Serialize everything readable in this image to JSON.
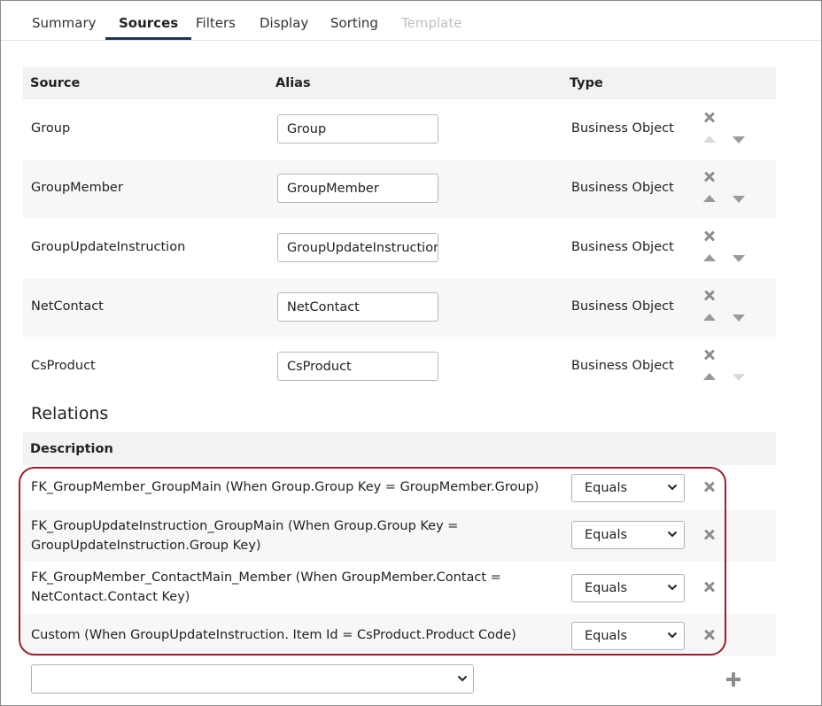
{
  "tabs": [
    {
      "label": "Summary",
      "state": "normal"
    },
    {
      "label": "Sources",
      "state": "active"
    },
    {
      "label": "Filters",
      "state": "normal"
    },
    {
      "label": "Display",
      "state": "normal"
    },
    {
      "label": "Sorting",
      "state": "normal"
    },
    {
      "label": "Template",
      "state": "disabled"
    }
  ],
  "sources": {
    "headers": {
      "source": "Source",
      "alias": "Alias",
      "type": "Type"
    },
    "rows": [
      {
        "source": "Group",
        "alias": "Group",
        "type": "Business Object"
      },
      {
        "source": "GroupMember",
        "alias": "GroupMember",
        "type": "Business Object"
      },
      {
        "source": "GroupUpdateInstruction",
        "alias": "GroupUpdateInstruction",
        "type": "Business Object"
      },
      {
        "source": "NetContact",
        "alias": "NetContact",
        "type": "Business Object"
      },
      {
        "source": "CsProduct",
        "alias": "CsProduct",
        "type": "Business Object"
      }
    ]
  },
  "relations": {
    "title": "Relations",
    "header": "Description",
    "rows": [
      {
        "description": "FK_GroupMember_GroupMain (When Group.Group Key = GroupMember.Group)",
        "operator": "Equals"
      },
      {
        "description": "FK_GroupUpdateInstruction_GroupMain (When Group.Group Key = GroupUpdateInstruction.Group Key)",
        "operator": "Equals"
      },
      {
        "description": "FK_GroupMember_ContactMain_Member (When GroupMember.Contact = NetContact.Contact Key)",
        "operator": "Equals"
      },
      {
        "description": "Custom (When GroupUpdateInstruction. Item Id = CsProduct.Product Code)",
        "operator": "Equals"
      }
    ],
    "new_relation_value": ""
  },
  "colors": {
    "active_tab_underline": "#1d3557",
    "highlight_border": "#9e1d2c",
    "icon_gray": "#8d8d8d"
  },
  "icons": {
    "remove": "close-icon",
    "move_up": "arrow-up-icon",
    "move_down": "arrow-down-icon",
    "add": "plus-icon",
    "dropdown": "chevron-down-icon"
  }
}
